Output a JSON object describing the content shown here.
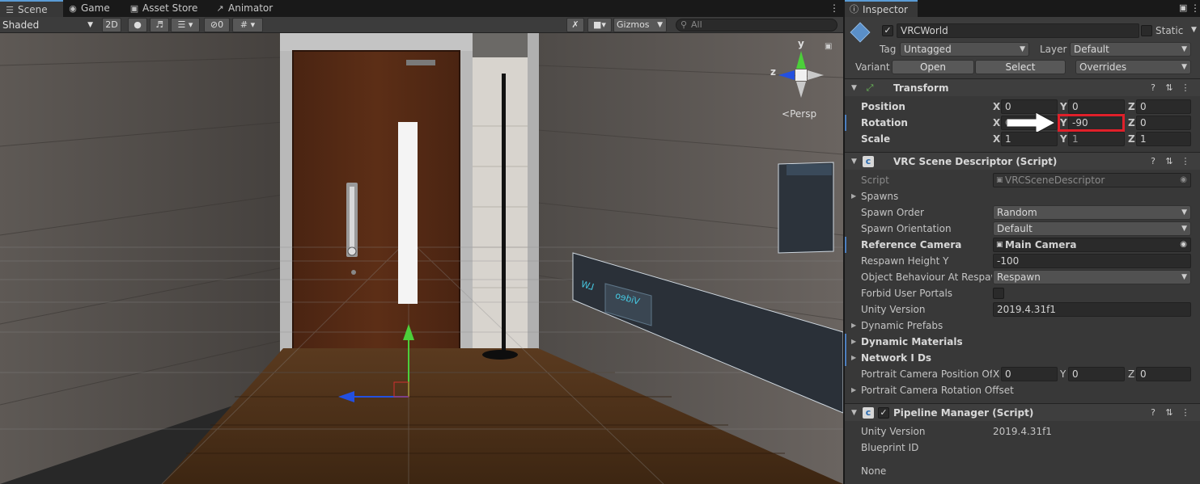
{
  "scene_tabs": {
    "scene": "Scene",
    "game": "Game",
    "asset_store": "Asset Store",
    "animator": "Animator"
  },
  "scene_toolbar": {
    "shading": "Shaded",
    "two_d": "2D",
    "hidden_count": "0",
    "gizmos": "Gizmos",
    "search_placeholder": "All"
  },
  "viewport": {
    "persp_label": "Persp",
    "axis_y": "y",
    "axis_z": "z",
    "sign_left": "LW",
    "sign_right": "Video"
  },
  "inspector": {
    "tab": "Inspector",
    "object": {
      "name": "VRCWorld",
      "static_label": "Static",
      "tag_label": "Tag",
      "tag_value": "Untagged",
      "layer_label": "Layer",
      "layer_value": "Default",
      "variant_label": "Variant",
      "open_btn": "Open",
      "select_btn": "Select",
      "overrides_btn": "Overrides"
    },
    "transform": {
      "title": "Transform",
      "position_label": "Position",
      "rotation_label": "Rotation",
      "scale_label": "Scale",
      "x": "X",
      "y": "Y",
      "z": "Z",
      "position": [
        "0",
        "0",
        "0"
      ],
      "rotation": [
        "0",
        "-90",
        "0"
      ],
      "scale": [
        "1",
        "1",
        "1"
      ]
    },
    "descriptor": {
      "title": "VRC Scene Descriptor (Script)",
      "script_label": "Script",
      "script_value": "VRCSceneDescriptor",
      "spawns_label": "Spawns",
      "spawn_order_label": "Spawn Order",
      "spawn_order_value": "Random",
      "spawn_orientation_label": "Spawn Orientation",
      "spawn_orientation_value": "Default",
      "ref_camera_label": "Reference Camera",
      "ref_camera_value": "Main Camera",
      "respawn_height_label": "Respawn Height Y",
      "respawn_height_value": "-100",
      "object_behaviour_label": "Object Behaviour At Respaw",
      "object_behaviour_value": "Respawn",
      "forbid_portals_label": "Forbid User Portals",
      "unity_version_label": "Unity Version",
      "unity_version_value": "2019.4.31f1",
      "dynamic_prefabs_label": "Dynamic Prefabs",
      "dynamic_materials_label": "Dynamic Materials",
      "network_ids_label": "Network I Ds",
      "portrait_pos_label": "Portrait Camera Position Offs",
      "portrait_pos": [
        "0",
        "0",
        "0"
      ],
      "portrait_rot_label": "Portrait Camera Rotation Offset"
    },
    "pipeline": {
      "title": "Pipeline Manager (Script)",
      "unity_version_label": "Unity Version",
      "unity_version_value": "2019.4.31f1",
      "blueprint_label": "Blueprint ID",
      "none_label": "None"
    }
  },
  "colors": {
    "highlight_box": "#e0202a",
    "accent_blue": "#4c7fc0",
    "gizmo_green": "#4ccf3a",
    "gizmo_blue": "#2350e0",
    "gizmo_red": "#d03030"
  }
}
